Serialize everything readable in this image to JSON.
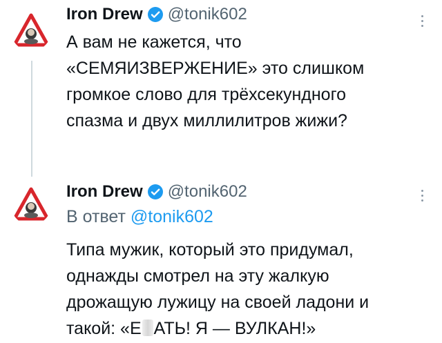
{
  "tweets": [
    {
      "author_name": "Iron Drew",
      "handle": "@tonik602",
      "lines": [
        "А вам не кажется, что",
        "«СЕМЯИЗВЕРЖЕНИЕ» это слишком",
        "громкое слово для трёхсекундного",
        "спазма и двух миллилитров жижи?"
      ]
    },
    {
      "author_name": "Iron Drew",
      "handle": "@tonik602",
      "reply_prefix": "В ответ",
      "reply_mention": "@tonik602",
      "lines": [
        "Типа мужик, который это придумал,",
        "однажды смотрел на эту жалкую",
        "дрожащую лужицу на своей ладони и"
      ],
      "last_line_before": "такой: «Е",
      "last_line_after": "АТЬ! Я — ВУЛКАН!»"
    }
  ],
  "icons": {
    "avatar": "warning-sign-avatar-icon",
    "verified": "verified-badge-icon",
    "more": "more-options-icon"
  },
  "colors": {
    "text": "#0f1419",
    "secondary": "#536471",
    "link": "#1d9bf0",
    "thread_line": "#cfd9de"
  }
}
